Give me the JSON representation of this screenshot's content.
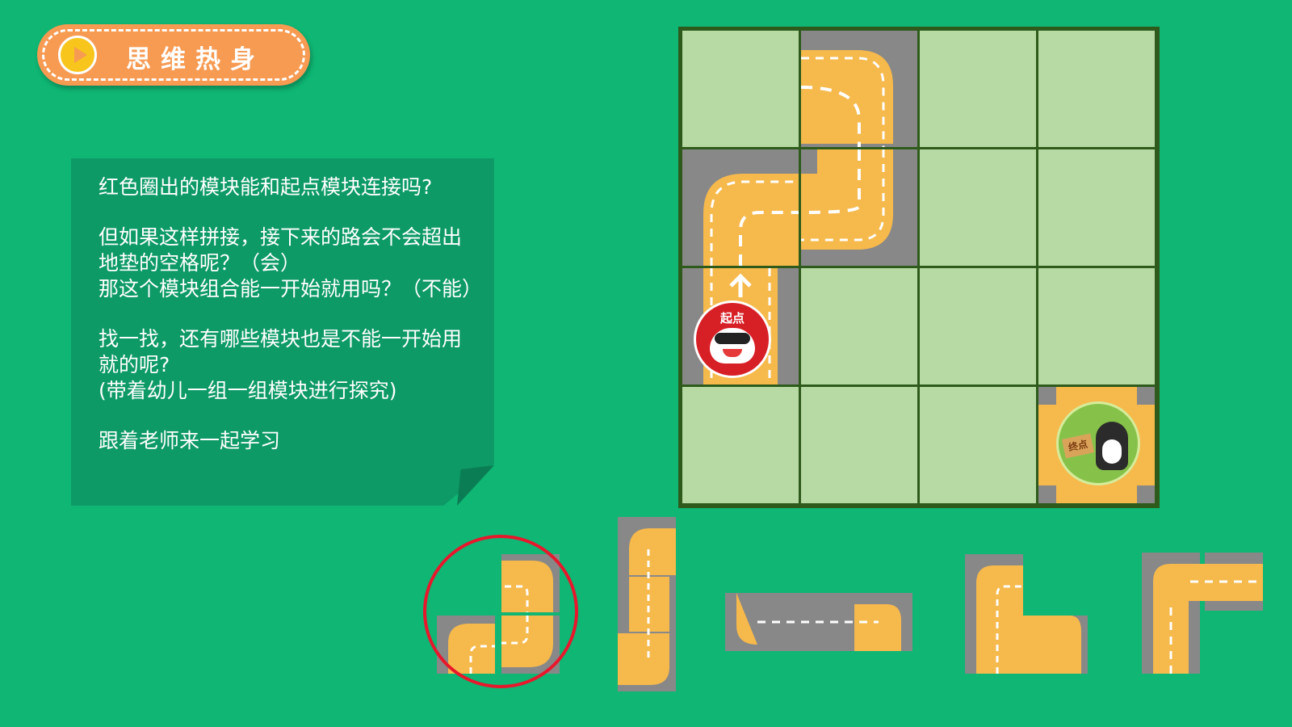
{
  "header": {
    "title": "思维热身",
    "play_icon": "play-icon"
  },
  "note": {
    "paragraphs": [
      "红色圈出的模块能和起点模块连接吗?",
      "但如果这样拼接，接下来的路会不会超出地垫的空格呢？（会）\n那这个模块组合能一开始就用吗？（不能）",
      "找一找，还有哪些模块也是不能一开始用就的呢?\n(带着幼儿一组一组模块进行探究)",
      "跟着老师来一起学习"
    ]
  },
  "board": {
    "rows": 4,
    "cols": 4,
    "start_label": "起点",
    "goal_label": "终点"
  },
  "pieces": {
    "groups": [
      "circled-group",
      "vertical-group",
      "horizontal-group",
      "step-group",
      "l-group"
    ]
  },
  "colors": {
    "background": "#0fb674",
    "grass": "#b7d9a3",
    "road": "#f6b94c",
    "asphalt": "#888888",
    "highlight": "#e8172c"
  }
}
